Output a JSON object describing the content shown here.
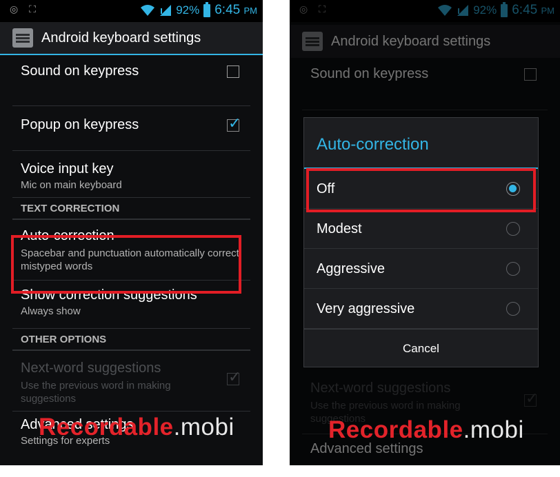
{
  "status_bar": {
    "battery_percent": "92%",
    "time": "6:45",
    "time_suffix": "PM"
  },
  "action_bar": {
    "title": "Android keyboard settings"
  },
  "settings": {
    "sound_on_keypress": {
      "title": "Sound on keypress",
      "checked": false
    },
    "popup_on_keypress": {
      "title": "Popup on keypress",
      "checked": true
    },
    "voice_input_key": {
      "title": "Voice input key",
      "summary": "Mic on main keyboard"
    },
    "text_correction_header": "TEXT CORRECTION",
    "auto_correction": {
      "title": "Auto-correction",
      "summary": "Spacebar and punctuation automatically correct mistyped words"
    },
    "show_correction_suggestions": {
      "title": "Show correction suggestions",
      "summary": "Always show"
    },
    "other_options_header": "OTHER OPTIONS",
    "next_word_suggestions": {
      "title": "Next-word suggestions",
      "summary": "Use the previous word in making suggestions",
      "checked": true,
      "enabled": false
    },
    "advanced_settings": {
      "title": "Advanced settings",
      "summary": "Settings for experts"
    }
  },
  "dialog": {
    "title": "Auto-correction",
    "options": [
      "Off",
      "Modest",
      "Aggressive",
      "Very aggressive"
    ],
    "selected": "Off",
    "cancel_label": "Cancel"
  },
  "watermark": {
    "brand_red": "Record",
    "brand_red_bold": "able",
    "brand_suffix": ".mobi"
  },
  "colors": {
    "accent": "#33b5e5",
    "highlight": "#e21d25",
    "background": "#0d0e10"
  }
}
